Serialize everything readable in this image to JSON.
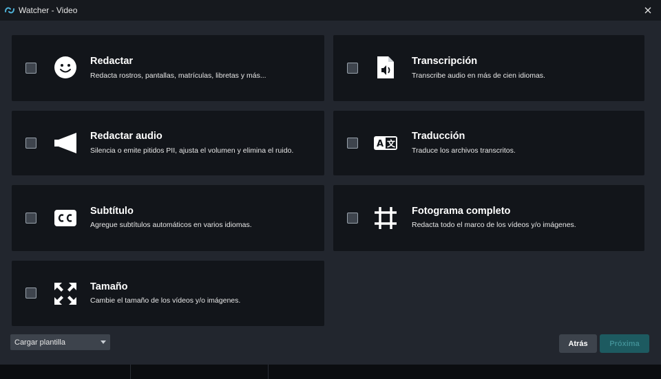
{
  "window": {
    "title": "Watcher - Video"
  },
  "cards": [
    {
      "title": "Redactar",
      "desc": "Redacta rostros, pantallas, matrículas, libretas y más...",
      "icon": "smiley-face-icon",
      "checked": false
    },
    {
      "title": "Transcripción",
      "desc": "Transcribe audio en más de cien idiomas.",
      "icon": "audio-file-icon",
      "checked": false
    },
    {
      "title": "Redactar audio",
      "desc": "Silencia o emite pitidos PII, ajusta el volumen y elimina el ruido.",
      "icon": "speaker-icon",
      "checked": false
    },
    {
      "title": "Traducción",
      "desc": "Traduce los archivos transcritos.",
      "icon": "translate-icon",
      "checked": false
    },
    {
      "title": "Subtítulo",
      "desc": "Agregue subtítulos automáticos en varios idiomas.",
      "icon": "closed-caption-icon",
      "checked": false
    },
    {
      "title": "Fotograma completo",
      "desc": "Redacta todo el marco de los vídeos y/o imágenes.",
      "icon": "crop-frame-icon",
      "checked": false
    },
    {
      "title": "Tamaño",
      "desc": "Cambie el tamaño de los vídeos y/o imágenes.",
      "icon": "resize-arrows-icon",
      "checked": false
    }
  ],
  "footer": {
    "template_select": "Cargar plantilla",
    "back_label": "Atrás",
    "next_label": "Próxima"
  },
  "colors": {
    "accent_disabled": "#1d5a60",
    "card_bg": "#12151a",
    "panel_bg": "#22262e"
  }
}
